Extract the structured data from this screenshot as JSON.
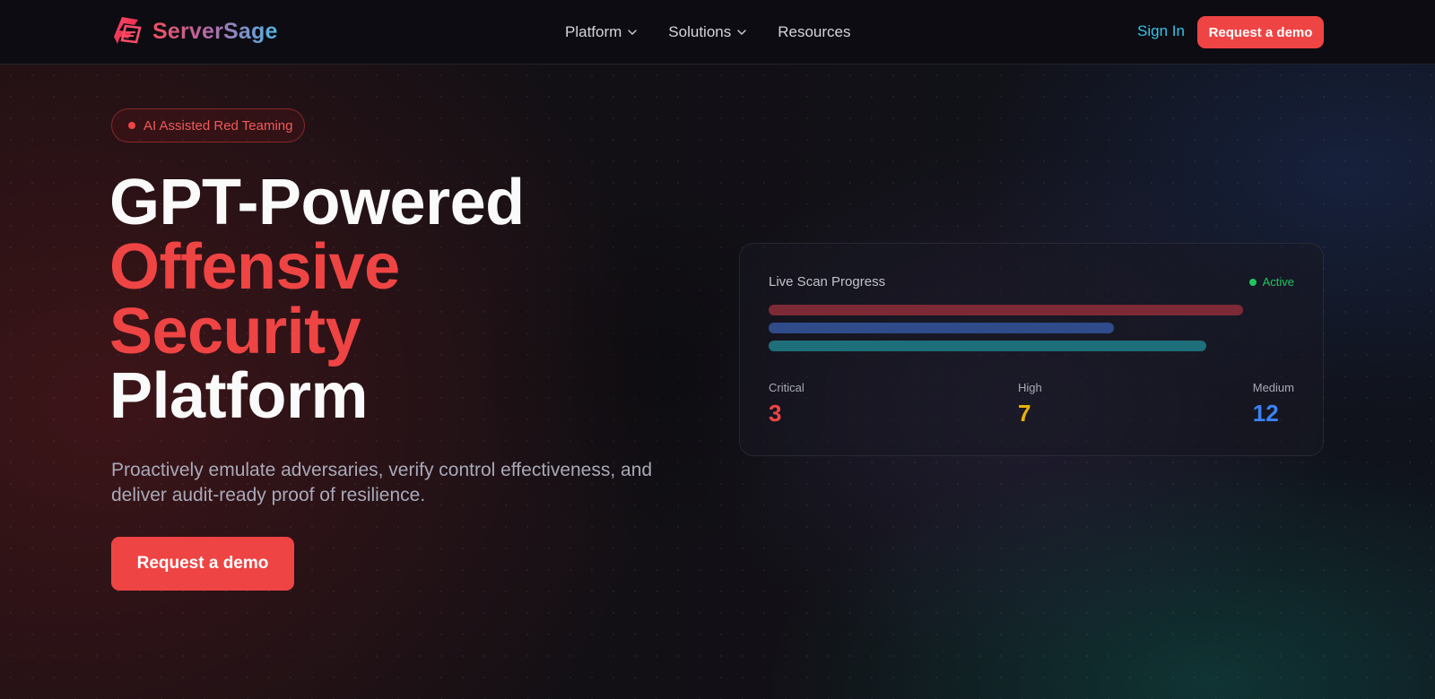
{
  "brand": {
    "name": "ServerSage"
  },
  "nav": {
    "items": [
      {
        "label": "Platform",
        "dropdown": true
      },
      {
        "label": "Solutions",
        "dropdown": true
      },
      {
        "label": "Resources",
        "dropdown": false
      }
    ],
    "sign_in": "Sign In",
    "cta": "Request a demo"
  },
  "hero": {
    "badge": "AI Assisted Red Teaming",
    "title_lines": [
      "GPT-Powered",
      "Offensive",
      "Security",
      "Platform"
    ],
    "subtitle_line1": "Proactively emulate adversaries, verify control effectiveness, and",
    "subtitle_line2": "deliver audit-ready proof of resilience.",
    "cta": "Request a demo"
  },
  "scan_card": {
    "title": "Live Scan Progress",
    "status": "Active",
    "progress_bars": [
      {
        "color": "#7c2a35",
        "fraction": 0.9
      },
      {
        "color": "#2f4b8a",
        "fraction": 0.655
      },
      {
        "color": "#1f6f7a",
        "fraction": 0.83
      }
    ],
    "stats": [
      {
        "label": "Critical",
        "value": "3",
        "color": "#ef4444"
      },
      {
        "label": "High",
        "value": "7",
        "color": "#eab308"
      },
      {
        "label": "Medium",
        "value": "12",
        "color": "#3b82f6"
      }
    ]
  },
  "colors": {
    "accent": "#ef4444",
    "link": "#37c2e6",
    "active": "#22c55e"
  }
}
